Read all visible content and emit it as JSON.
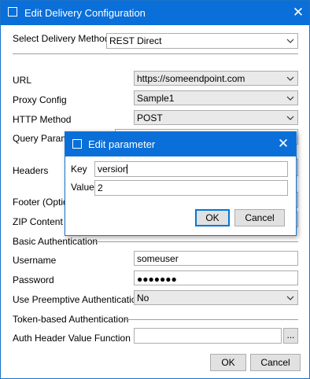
{
  "window": {
    "title": "Edit Delivery Configuration",
    "close_icon": "close-icon",
    "accent": "#0a6fd8"
  },
  "delivery_method": {
    "label": "Select Delivery Method",
    "value": "REST Direct"
  },
  "fields": {
    "url": {
      "label": "URL",
      "value": "https://someendpoint.com"
    },
    "proxy_config": {
      "label": "Proxy Config",
      "value": "Sample1"
    },
    "http_method": {
      "label": "HTTP Method",
      "value": "POST"
    },
    "query_params": {
      "label": "Query Parame"
    },
    "headers": {
      "label": "Headers"
    },
    "footer": {
      "label": "Footer (Optio"
    },
    "zip_content": {
      "label": "ZIP Content"
    },
    "basic_auth": {
      "label": "Basic Authentication"
    },
    "username": {
      "label": "Username",
      "value": "someuser"
    },
    "password": {
      "label": "Password",
      "value": "●●●●●●●"
    },
    "preemptive": {
      "label": "Use Preemptive Authentication",
      "value": "No"
    },
    "token_auth": {
      "label": "Token-based Authentication"
    },
    "auth_header_fn": {
      "label": "Auth Header Value Function",
      "value": "",
      "browse_label": "..."
    }
  },
  "footer_buttons": {
    "ok": "OK",
    "cancel": "Cancel"
  },
  "dialog": {
    "title": "Edit parameter",
    "key_label": "Key",
    "key_value": "version",
    "value_label": "Value",
    "value_value": "2",
    "ok": "OK",
    "cancel": "Cancel"
  }
}
